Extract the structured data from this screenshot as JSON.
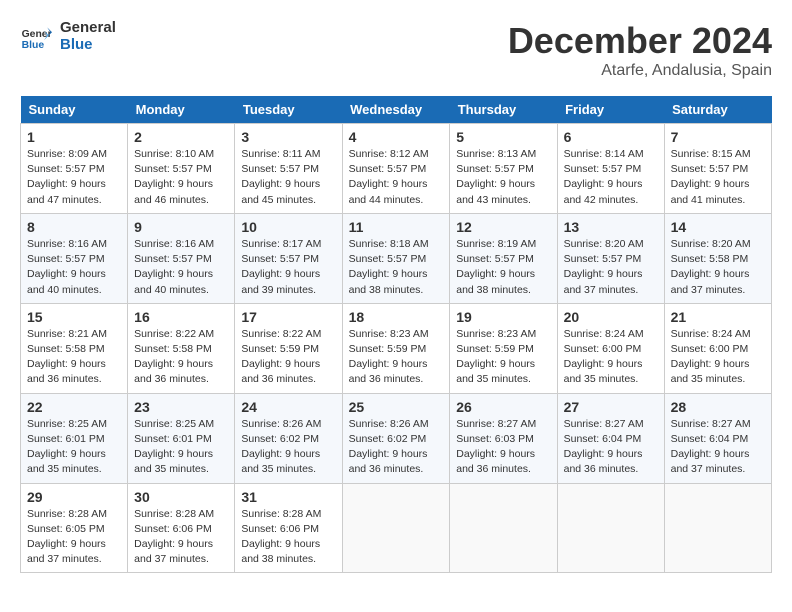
{
  "logo": {
    "line1": "General",
    "line2": "Blue"
  },
  "title": "December 2024",
  "location": "Atarfe, Andalusia, Spain",
  "headers": [
    "Sunday",
    "Monday",
    "Tuesday",
    "Wednesday",
    "Thursday",
    "Friday",
    "Saturday"
  ],
  "weeks": [
    [
      {
        "day": "1",
        "info": "Sunrise: 8:09 AM\nSunset: 5:57 PM\nDaylight: 9 hours\nand 47 minutes."
      },
      {
        "day": "2",
        "info": "Sunrise: 8:10 AM\nSunset: 5:57 PM\nDaylight: 9 hours\nand 46 minutes."
      },
      {
        "day": "3",
        "info": "Sunrise: 8:11 AM\nSunset: 5:57 PM\nDaylight: 9 hours\nand 45 minutes."
      },
      {
        "day": "4",
        "info": "Sunrise: 8:12 AM\nSunset: 5:57 PM\nDaylight: 9 hours\nand 44 minutes."
      },
      {
        "day": "5",
        "info": "Sunrise: 8:13 AM\nSunset: 5:57 PM\nDaylight: 9 hours\nand 43 minutes."
      },
      {
        "day": "6",
        "info": "Sunrise: 8:14 AM\nSunset: 5:57 PM\nDaylight: 9 hours\nand 42 minutes."
      },
      {
        "day": "7",
        "info": "Sunrise: 8:15 AM\nSunset: 5:57 PM\nDaylight: 9 hours\nand 41 minutes."
      }
    ],
    [
      {
        "day": "8",
        "info": "Sunrise: 8:16 AM\nSunset: 5:57 PM\nDaylight: 9 hours\nand 40 minutes."
      },
      {
        "day": "9",
        "info": "Sunrise: 8:16 AM\nSunset: 5:57 PM\nDaylight: 9 hours\nand 40 minutes."
      },
      {
        "day": "10",
        "info": "Sunrise: 8:17 AM\nSunset: 5:57 PM\nDaylight: 9 hours\nand 39 minutes."
      },
      {
        "day": "11",
        "info": "Sunrise: 8:18 AM\nSunset: 5:57 PM\nDaylight: 9 hours\nand 38 minutes."
      },
      {
        "day": "12",
        "info": "Sunrise: 8:19 AM\nSunset: 5:57 PM\nDaylight: 9 hours\nand 38 minutes."
      },
      {
        "day": "13",
        "info": "Sunrise: 8:20 AM\nSunset: 5:57 PM\nDaylight: 9 hours\nand 37 minutes."
      },
      {
        "day": "14",
        "info": "Sunrise: 8:20 AM\nSunset: 5:58 PM\nDaylight: 9 hours\nand 37 minutes."
      }
    ],
    [
      {
        "day": "15",
        "info": "Sunrise: 8:21 AM\nSunset: 5:58 PM\nDaylight: 9 hours\nand 36 minutes."
      },
      {
        "day": "16",
        "info": "Sunrise: 8:22 AM\nSunset: 5:58 PM\nDaylight: 9 hours\nand 36 minutes."
      },
      {
        "day": "17",
        "info": "Sunrise: 8:22 AM\nSunset: 5:59 PM\nDaylight: 9 hours\nand 36 minutes."
      },
      {
        "day": "18",
        "info": "Sunrise: 8:23 AM\nSunset: 5:59 PM\nDaylight: 9 hours\nand 36 minutes."
      },
      {
        "day": "19",
        "info": "Sunrise: 8:23 AM\nSunset: 5:59 PM\nDaylight: 9 hours\nand 35 minutes."
      },
      {
        "day": "20",
        "info": "Sunrise: 8:24 AM\nSunset: 6:00 PM\nDaylight: 9 hours\nand 35 minutes."
      },
      {
        "day": "21",
        "info": "Sunrise: 8:24 AM\nSunset: 6:00 PM\nDaylight: 9 hours\nand 35 minutes."
      }
    ],
    [
      {
        "day": "22",
        "info": "Sunrise: 8:25 AM\nSunset: 6:01 PM\nDaylight: 9 hours\nand 35 minutes."
      },
      {
        "day": "23",
        "info": "Sunrise: 8:25 AM\nSunset: 6:01 PM\nDaylight: 9 hours\nand 35 minutes."
      },
      {
        "day": "24",
        "info": "Sunrise: 8:26 AM\nSunset: 6:02 PM\nDaylight: 9 hours\nand 35 minutes."
      },
      {
        "day": "25",
        "info": "Sunrise: 8:26 AM\nSunset: 6:02 PM\nDaylight: 9 hours\nand 36 minutes."
      },
      {
        "day": "26",
        "info": "Sunrise: 8:27 AM\nSunset: 6:03 PM\nDaylight: 9 hours\nand 36 minutes."
      },
      {
        "day": "27",
        "info": "Sunrise: 8:27 AM\nSunset: 6:04 PM\nDaylight: 9 hours\nand 36 minutes."
      },
      {
        "day": "28",
        "info": "Sunrise: 8:27 AM\nSunset: 6:04 PM\nDaylight: 9 hours\nand 37 minutes."
      }
    ],
    [
      {
        "day": "29",
        "info": "Sunrise: 8:28 AM\nSunset: 6:05 PM\nDaylight: 9 hours\nand 37 minutes."
      },
      {
        "day": "30",
        "info": "Sunrise: 8:28 AM\nSunset: 6:06 PM\nDaylight: 9 hours\nand 37 minutes."
      },
      {
        "day": "31",
        "info": "Sunrise: 8:28 AM\nSunset: 6:06 PM\nDaylight: 9 hours\nand 38 minutes."
      },
      null,
      null,
      null,
      null
    ]
  ]
}
